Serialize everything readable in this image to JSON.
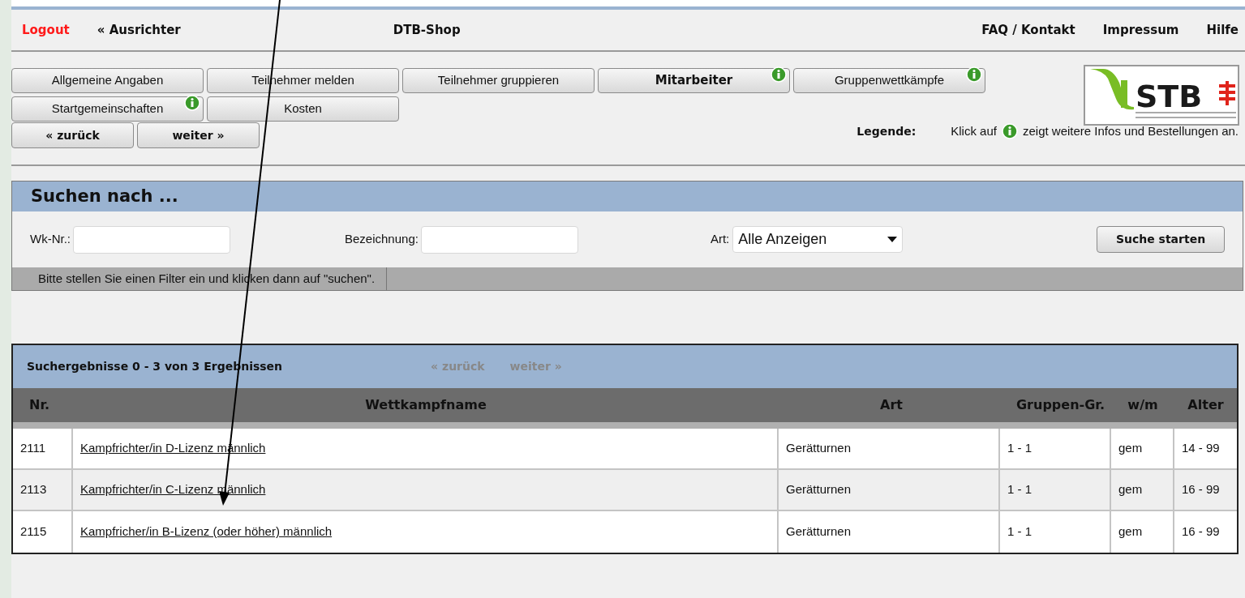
{
  "header": {
    "logout": "Logout",
    "back_link": "« Ausrichter",
    "title": "DTB-Shop",
    "links": [
      "FAQ / Kontakt",
      "Impressum",
      "Hilfe"
    ]
  },
  "nav_buttons": [
    {
      "label": "Allgemeine Angaben",
      "selected": false,
      "info": false
    },
    {
      "label": "Teilnehmer melden",
      "selected": false,
      "info": false
    },
    {
      "label": "Teilnehmer gruppieren",
      "selected": false,
      "info": false
    },
    {
      "label": "Mitarbeiter",
      "selected": true,
      "info": true
    },
    {
      "label": "Gruppenwettkämpfe",
      "selected": false,
      "info": true
    },
    {
      "label": "Startgemeinschaften",
      "selected": false,
      "info": true
    },
    {
      "label": "Kosten",
      "selected": false,
      "info": false
    }
  ],
  "logo_text": "STB",
  "pager_buttons": [
    "« zurück",
    "weiter »"
  ],
  "legend": {
    "label": "Legende:",
    "before": "Klick auf",
    "after": "zeigt weitere Infos und Bestellungen an."
  },
  "search": {
    "title": "Suchen nach ...",
    "fields": [
      {
        "label": "Wk-Nr.:"
      },
      {
        "label": "Bezeichnung:"
      }
    ],
    "select": {
      "label": "Art:",
      "value": "Alle Anzeigen"
    },
    "button": "Suche starten",
    "status": "Bitte stellen Sie einen Filter ein und klicken dann auf \"suchen\"."
  },
  "results": {
    "title": "Suchergebnisse 0 - 3 von 3 Ergebnissen",
    "prev": "« zurück",
    "next": "weiter »",
    "columns": [
      "Nr.",
      "Wettkampfname",
      "Art",
      "Gruppen-Gr.",
      "w/m",
      "Alter"
    ],
    "rows": [
      [
        "2111",
        "Kampfrichter/in D-Lizenz männlich",
        "Gerätturnen",
        "1 - 1",
        "gem",
        "14 - 99"
      ],
      [
        "2113",
        "Kampfrichter/in C-Lizenz männlich",
        "Gerätturnen",
        "1 - 1",
        "gem",
        "16 - 99"
      ],
      [
        "2115",
        "Kampfricher/in B-Lizenz (oder höher) männlich",
        "Gerätturnen",
        "1 - 1",
        "gem",
        "16 - 99"
      ]
    ]
  }
}
